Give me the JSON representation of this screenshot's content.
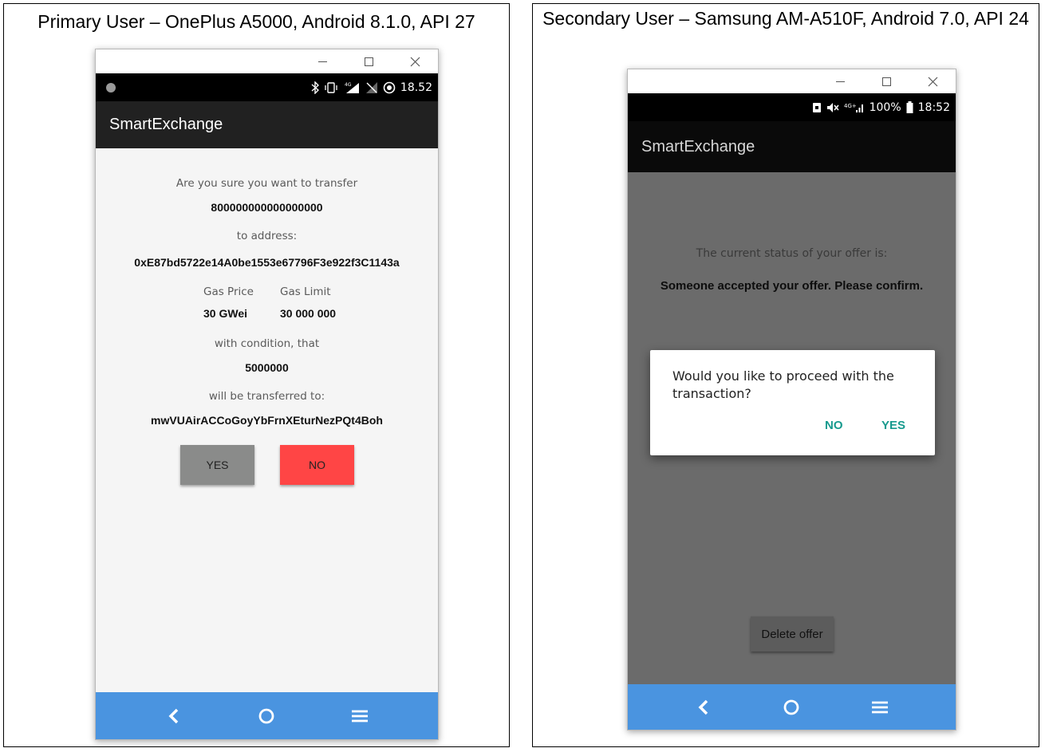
{
  "left_panel": {
    "caption": "Primary User – OnePlus A5000, Android 8.1.0, API 27",
    "status_time": "18.52",
    "app_title": "SmartExchange",
    "confirm_prompt": "Are you sure you want to transfer",
    "amount": "800000000000000000",
    "to_address_label": "to address:",
    "to_address": "0xE87bd5722e14A0be1553e67796F3e922f3C1143a",
    "gas_price_label": "Gas Price",
    "gas_price_value": "30 GWei",
    "gas_limit_label": "Gas Limit",
    "gas_limit_value": "30 000 000",
    "condition_label": "with condition, that",
    "condition_amount": "5000000",
    "transferred_to_label": "will be transferred to:",
    "transferred_to_address": "mwVUAirACCoGoyYbFrnXEturNezPQt4Boh",
    "yes_label": "YES",
    "no_label": "NO",
    "yes_color": "#8a8b8a",
    "no_color": "#ff4545"
  },
  "right_panel": {
    "caption": "Secondary User – Samsung AM-A510F, Android 7.0, API 24",
    "status_battery": "100%",
    "status_time": "18:52",
    "app_title": "SmartExchange",
    "status_label": "The current status of your offer is:",
    "status_value": "Someone accepted your offer. Please confirm.",
    "delete_offer_label": "Delete offer",
    "dialog_message": "Would you like to proceed with the transaction?",
    "dialog_no_label": "NO",
    "dialog_yes_label": "YES",
    "dialog_button_color": "#179a8e"
  },
  "theme": {
    "navbar_color": "#4a94e0",
    "appbar_color": "#212121"
  },
  "icons": {
    "window_controls": [
      "minimize-icon",
      "maximize-icon",
      "close-icon"
    ],
    "nav": [
      "back-icon",
      "home-icon",
      "menu-icon"
    ]
  }
}
